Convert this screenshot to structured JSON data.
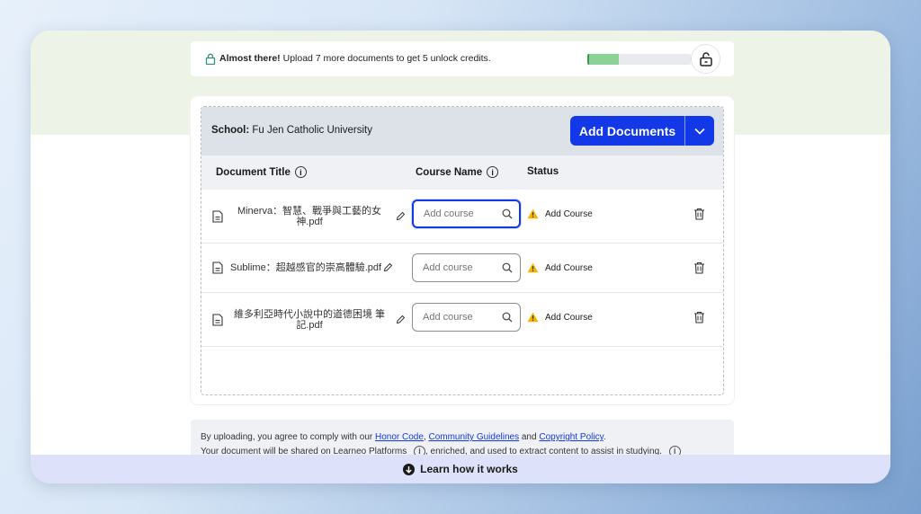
{
  "banner": {
    "bold": "Almost there!",
    "text": " Upload 7 more documents to get 5 unlock credits.",
    "progress_fraction": 0.3
  },
  "panel": {
    "school_label": "School:",
    "school_name": " Fu Jen Catholic University",
    "add_documents_label": "Add Documents"
  },
  "table": {
    "headers": {
      "title": "Document Title",
      "course": "Course Name",
      "status": "Status"
    },
    "rows": [
      {
        "title": "Minerva：智慧、戰爭與工藝的女神.pdf",
        "course_placeholder": "Add course",
        "status": "Add Course"
      },
      {
        "title": "Sublime：超越感官的崇高體驗.pdf",
        "course_placeholder": "Add course",
        "status": "Add Course"
      },
      {
        "title": "維多利亞時代小說中的道德困境 筆記.pdf",
        "course_placeholder": "Add course",
        "status": "Add Course"
      }
    ]
  },
  "legal": {
    "prefix": "By uploading, you agree to comply with our ",
    "honor_code": "Honor Code",
    "comma": ", ",
    "community_guidelines": "Community Guidelines",
    "and": " and ",
    "copyright_policy": "Copyright Policy",
    "period": ".",
    "line2": "Your document will be shared on Learneo Platforms",
    "line2_b": ", enriched, and used to extract content to assist in studying."
  },
  "learn": {
    "label": "Learn how it works"
  },
  "colors": {
    "primary": "#1238e8",
    "progress": "#8cd196",
    "warning": "#f5b400"
  }
}
